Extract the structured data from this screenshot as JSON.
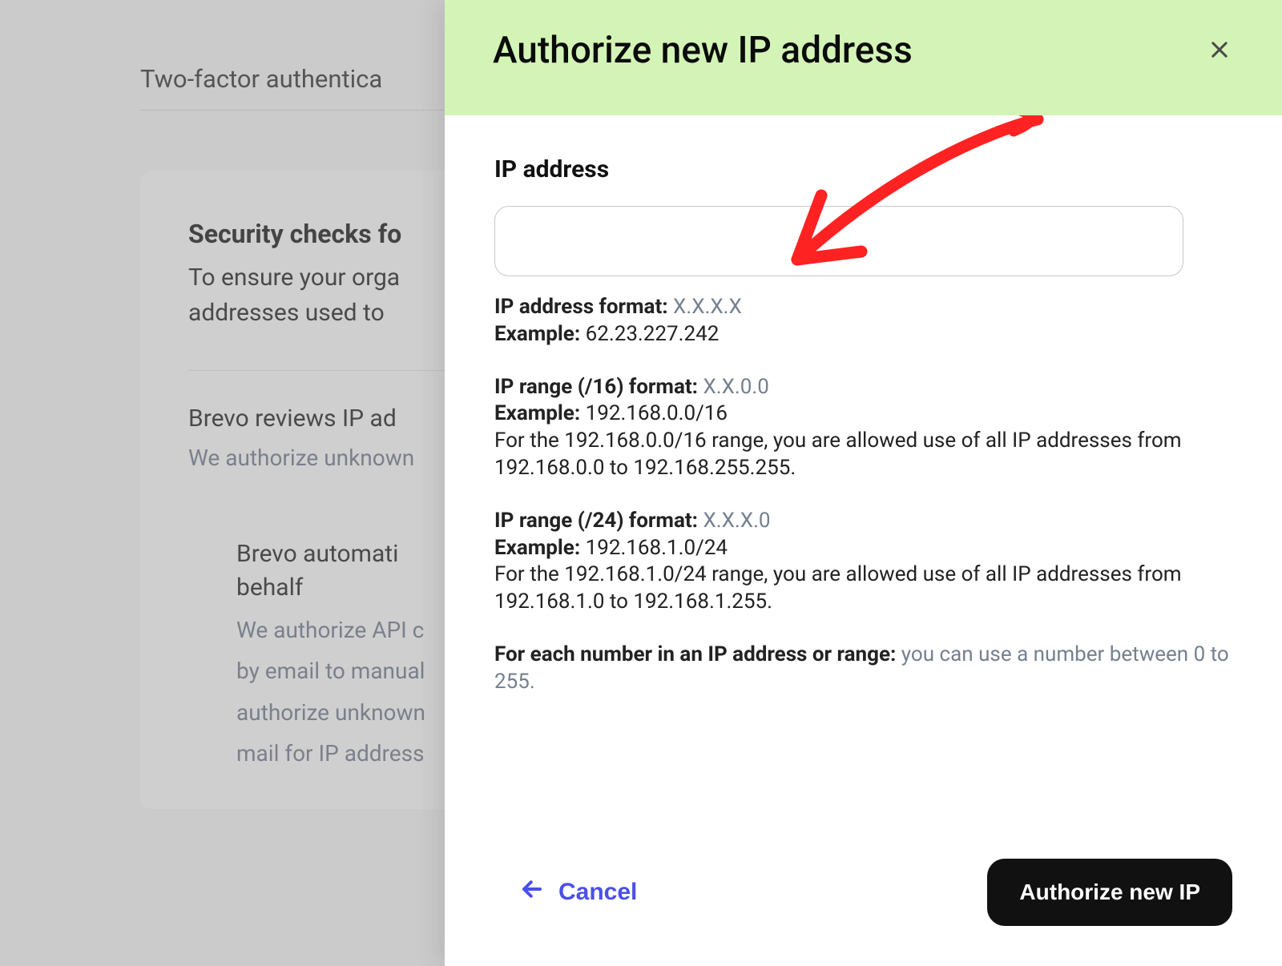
{
  "bg": {
    "tab": "Two-factor authentica",
    "card_title": "Security checks fo",
    "card_line1": "To ensure your orga",
    "card_line2": "addresses used to",
    "sec2_title": "Brevo reviews IP ad",
    "sec2_sub": "We authorize unknown ",
    "sec3_title_l1": "Brevo automati",
    "sec3_title_l2": "behalf",
    "sec3_p1": "We authorize API c",
    "sec3_p2": "by email to manual",
    "sec3_p3": "authorize unknown",
    "sec3_p4": "mail for IP address"
  },
  "dialog": {
    "title": "Authorize new IP address",
    "field_label": "IP address",
    "format1_label": "IP address format:",
    "format1_value": "X.X.X.X",
    "example_label": "Example:",
    "example1_value": "62.23.227.242",
    "format2_label": "IP range (/16) format:",
    "format2_value": "X.X.0.0",
    "example2_value": "192.168.0.0/16",
    "desc2": "For the 192.168.0.0/16 range, you are allowed use of all IP addresses from 192.168.0.0 to 192.168.255.255.",
    "format3_label": "IP range (/24) format:",
    "format3_value": "X.X.X.0",
    "example3_value": "192.168.1.0/24",
    "desc3": "For the 192.168.1.0/24 range, you are allowed use of all IP addresses from 192.168.1.0 to 192.168.1.255.",
    "note_label": "For each number in an IP address or range:",
    "note_value": "you can use a number between 0 to 255.",
    "cancel": "Cancel",
    "submit": "Authorize new IP"
  }
}
